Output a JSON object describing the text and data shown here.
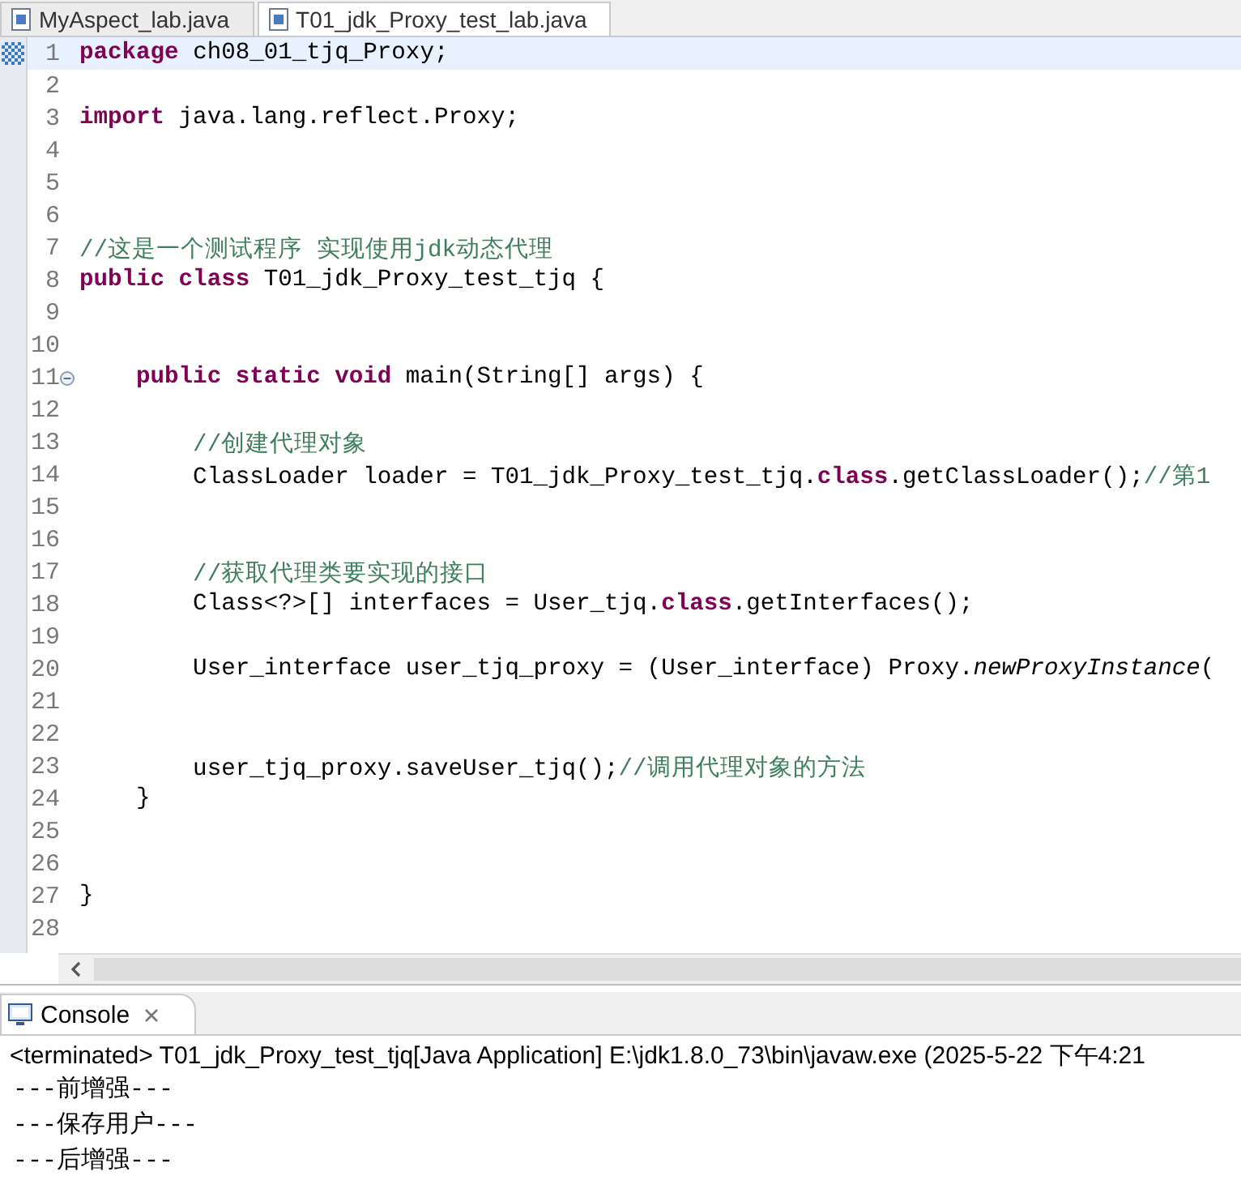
{
  "editor_tabs": [
    {
      "label": "MyAspect_lab.java",
      "selected": false
    },
    {
      "label": "T01_jdk_Proxy_test_lab.java",
      "selected": true
    }
  ],
  "editor": {
    "lines": [
      {
        "number": "1",
        "current": true,
        "foldable": false,
        "segments": [
          {
            "kind": "keyword",
            "text": "package"
          },
          {
            "kind": "plain",
            "text": " ch08_01_tjq_Proxy;"
          }
        ]
      },
      {
        "number": "2",
        "current": false,
        "foldable": false
      },
      {
        "number": "3",
        "current": false,
        "foldable": false,
        "segments": [
          {
            "kind": "keyword",
            "text": "import"
          },
          {
            "kind": "plain",
            "text": " java.lang.reflect.Proxy;"
          }
        ]
      },
      {
        "number": "4",
        "current": false,
        "foldable": false
      },
      {
        "number": "5",
        "current": false,
        "foldable": false
      },
      {
        "number": "6",
        "current": false,
        "foldable": false
      },
      {
        "number": "7",
        "current": false,
        "foldable": false,
        "segments": [
          {
            "kind": "comment",
            "text": "//这是一个测试程序 实现使用jdk动态代理"
          }
        ]
      },
      {
        "number": "8",
        "current": false,
        "foldable": false,
        "segments": [
          {
            "kind": "keyword",
            "text": "public class"
          },
          {
            "kind": "plain",
            "text": " T01_jdk_Proxy_test_tjq {"
          }
        ]
      },
      {
        "number": "9",
        "current": false,
        "foldable": false
      },
      {
        "number": "10",
        "current": false,
        "foldable": false
      },
      {
        "number": "11",
        "current": false,
        "foldable": true,
        "segments": [
          {
            "kind": "keyword",
            "text": "    public static void"
          },
          {
            "kind": "plain",
            "text": " main(String[] args) {"
          }
        ]
      },
      {
        "number": "12",
        "current": false,
        "foldable": false
      },
      {
        "number": "13",
        "current": false,
        "foldable": false,
        "segments": [
          {
            "kind": "comment",
            "text": "        //创建代理对象"
          }
        ]
      },
      {
        "number": "14",
        "current": false,
        "foldable": false,
        "segments": [
          {
            "kind": "plain",
            "text": "        ClassLoader loader = T01_jdk_Proxy_test_tjq."
          },
          {
            "kind": "keyword",
            "text": "class"
          },
          {
            "kind": "plain",
            "text": ".getClassLoader();"
          },
          {
            "kind": "comment",
            "text": "//第1"
          }
        ]
      },
      {
        "number": "15",
        "current": false,
        "foldable": false
      },
      {
        "number": "16",
        "current": false,
        "foldable": false
      },
      {
        "number": "17",
        "current": false,
        "foldable": false,
        "segments": [
          {
            "kind": "comment",
            "text": "        //获取代理类要实现的接口"
          }
        ]
      },
      {
        "number": "18",
        "current": false,
        "foldable": false,
        "segments": [
          {
            "kind": "plain",
            "text": "        Class<?>[] interfaces = User_tjq."
          },
          {
            "kind": "keyword",
            "text": "class"
          },
          {
            "kind": "plain",
            "text": ".getInterfaces();"
          }
        ]
      },
      {
        "number": "19",
        "current": false,
        "foldable": false
      },
      {
        "number": "20",
        "current": false,
        "foldable": false,
        "segments": [
          {
            "kind": "plain",
            "text": "        User_interface user_tjq_proxy = (User_interface) Proxy."
          },
          {
            "kind": "italic",
            "text": "newProxyInstance"
          },
          {
            "kind": "plain",
            "text": "("
          }
        ]
      },
      {
        "number": "21",
        "current": false,
        "foldable": false
      },
      {
        "number": "22",
        "current": false,
        "foldable": false
      },
      {
        "number": "23",
        "current": false,
        "foldable": false,
        "segments": [
          {
            "kind": "plain",
            "text": "        user_tjq_proxy.saveUser_tjq();"
          },
          {
            "kind": "comment",
            "text": "//调用代理对象的方法"
          }
        ]
      },
      {
        "number": "24",
        "current": false,
        "foldable": false,
        "segments": [
          {
            "kind": "plain",
            "text": "    }"
          }
        ]
      },
      {
        "number": "25",
        "current": false,
        "foldable": false
      },
      {
        "number": "26",
        "current": false,
        "foldable": false
      },
      {
        "number": "27",
        "current": false,
        "foldable": false,
        "segments": [
          {
            "kind": "plain",
            "text": "}"
          }
        ]
      },
      {
        "number": "28",
        "current": false,
        "foldable": false
      }
    ]
  },
  "console": {
    "tab": {
      "label": "Console"
    },
    "status": "<terminated> T01_jdk_Proxy_test_tjq[Java Application] E:\\jdk1.8.0_73\\bin\\javaw.exe (2025-5-22 下午4:21",
    "output": [
      "---前增强---",
      "---保存用户---",
      "---后增强---"
    ]
  }
}
